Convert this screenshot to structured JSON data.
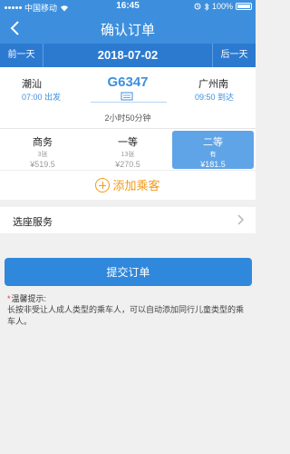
{
  "status": {
    "carrier": "中国移动",
    "time": "16:45",
    "battery": "100%"
  },
  "nav": {
    "title": "确认订单"
  },
  "date_bar": {
    "prev_label": "前一天",
    "date": "2018-07-02",
    "next_label": "后一天"
  },
  "train": {
    "number": "G6347",
    "from_station": "潮汕",
    "from_time": "07:00 出发",
    "to_station": "广州南",
    "to_time": "09:50 到达",
    "duration": "2小时50分钟"
  },
  "seats": [
    {
      "class": "商务",
      "count": "3张",
      "price": "¥519.5",
      "selected": false
    },
    {
      "class": "一等",
      "count": "13张",
      "price": "¥270.5",
      "selected": false
    },
    {
      "class": "二等",
      "count": "有",
      "price": "¥181.5",
      "selected": true
    }
  ],
  "add_passenger": {
    "label": "添加乘客"
  },
  "seat_service": {
    "label": "选座服务"
  },
  "submit": {
    "label": "提交订单"
  },
  "tips": {
    "title": "温馨提示:",
    "body": "长按非受让人成人类型的乘车人，可以自动添加同行儿童类型的乘车人。"
  },
  "colors": {
    "primary": "#3d8fdd",
    "date_bar": "#2c7ad0",
    "accent": "#f19a1a",
    "selected_seat": "#5fa4e6"
  }
}
